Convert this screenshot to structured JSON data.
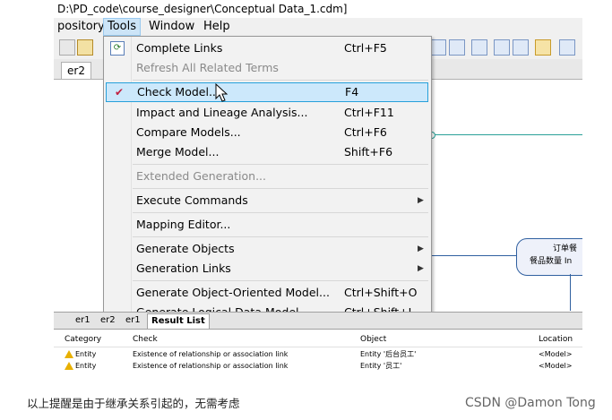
{
  "window": {
    "path": "D:\\PD_code\\course_designer\\Conceptual Data_1.cdm]"
  },
  "menubar": {
    "items": [
      "pository",
      "Tools",
      "Window",
      "Help"
    ]
  },
  "diagram_tabs": [
    "er2"
  ],
  "menu": {
    "items": [
      {
        "label": "Complete Links",
        "shortcut": "Ctrl+F5"
      },
      {
        "label": "Refresh All Related Terms",
        "shortcut": ""
      },
      {
        "label": "Check Model...",
        "shortcut": "F4"
      },
      {
        "label": "Impact and Lineage Analysis...",
        "shortcut": "Ctrl+F11"
      },
      {
        "label": "Compare Models...",
        "shortcut": "Ctrl+F6"
      },
      {
        "label": "Merge Model...",
        "shortcut": "Shift+F6"
      },
      {
        "label": "Extended Generation...",
        "shortcut": ""
      },
      {
        "label": "Execute Commands",
        "shortcut": ""
      },
      {
        "label": "Mapping Editor...",
        "shortcut": ""
      },
      {
        "label": "Generate Objects",
        "shortcut": ""
      },
      {
        "label": "Generation Links",
        "shortcut": ""
      },
      {
        "label": "Generate Object-Oriented Model...",
        "shortcut": "Ctrl+Shift+O"
      },
      {
        "label": "Generate Logical Data Model...",
        "shortcut": "Ctrl+Shift+L"
      }
    ]
  },
  "entity": {
    "title": "订单餐",
    "row": "餐品数量  In"
  },
  "result_panel": {
    "tabs": [
      "er1",
      "er2",
      "er1",
      "Result List"
    ],
    "headers": [
      "Category",
      "Check",
      "Object",
      "Location"
    ],
    "rows": [
      {
        "category": "Entity",
        "check": "Existence of relationship or association link",
        "object": "Entity '后台员工'",
        "location": "<Model>"
      },
      {
        "category": "Entity",
        "check": "Existence of relationship or association link",
        "object": "Entity '员工'",
        "location": "<Model>"
      }
    ]
  },
  "caption": "以上提醒是由于继承关系引起的，无需考虑",
  "watermark": "CSDN @Damon Tong"
}
